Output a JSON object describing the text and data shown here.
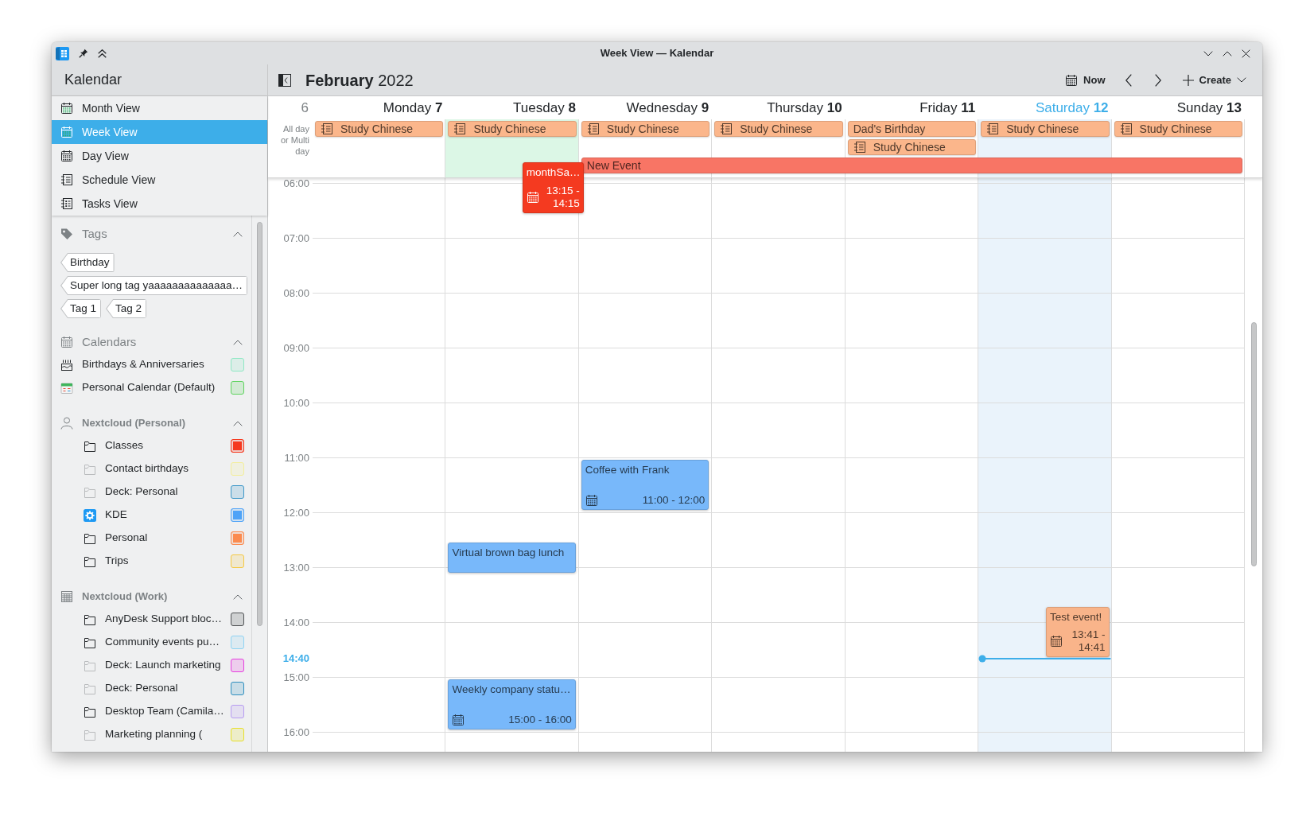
{
  "window": {
    "title": "Week View — Kalendar"
  },
  "sidebar": {
    "title": "Kalendar",
    "views": [
      {
        "label": "Month View",
        "kind": "month",
        "selected": false
      },
      {
        "label": "Week View",
        "kind": "week",
        "selected": true
      },
      {
        "label": "Day View",
        "kind": "day",
        "selected": false
      },
      {
        "label": "Schedule View",
        "kind": "schedule",
        "selected": false
      },
      {
        "label": "Tasks View",
        "kind": "tasks",
        "selected": false
      }
    ],
    "sections": [
      {
        "title": "Tags",
        "kind": "tags",
        "expanded": true,
        "tags": [
          "Birthday",
          "Super long tag yaaaaaaaaaaaaaa…",
          "Tag 1",
          "Tag 2"
        ]
      },
      {
        "title": "Calendars",
        "kind": "local",
        "expanded": true,
        "items": [
          {
            "label": "Birthdays & Anniversaries",
            "kind": "birthdays",
            "color": "#8fe8c4",
            "checked": false
          },
          {
            "label": "Personal Calendar (Default)",
            "kind": "calendar",
            "color": "#5ed35e",
            "checked": false
          }
        ]
      },
      {
        "title": "Nextcloud (Personal)",
        "kind": "account",
        "expanded": true,
        "items": [
          {
            "label": "Classes",
            "kind": "folder",
            "dimmed": false,
            "color": "#f5391f",
            "checked": true
          },
          {
            "label": "Contact birthdays",
            "kind": "folder",
            "dimmed": true,
            "color": "#f3ee9c",
            "checked": false
          },
          {
            "label": "Deck: Personal",
            "kind": "folder",
            "dimmed": true,
            "color": "#3d97c8",
            "checked": false
          },
          {
            "label": "KDE",
            "kind": "logo",
            "color": "#4fa3f7",
            "checked": true
          },
          {
            "label": "Personal",
            "kind": "folder",
            "dimmed": false,
            "color": "#fb8b4f",
            "checked": true
          },
          {
            "label": "Trips",
            "kind": "folder",
            "dimmed": false,
            "color": "#f5c842",
            "checked": false
          }
        ]
      },
      {
        "title": "Nextcloud (Work)",
        "kind": "shared",
        "expanded": true,
        "items": [
          {
            "label": "AnyDesk Support bloc…",
            "kind": "folder",
            "dimmed": false,
            "color": "#505355",
            "checked": false
          },
          {
            "label": "Community events pu…",
            "kind": "folder",
            "dimmed": false,
            "color": "#8fd3f3",
            "checked": false
          },
          {
            "label": "Deck: Launch marketing",
            "kind": "folder",
            "dimmed": true,
            "color": "#e63fdf",
            "checked": false
          },
          {
            "label": "Deck: Personal",
            "kind": "folder",
            "dimmed": true,
            "color": "#2f8fbf",
            "checked": false
          },
          {
            "label": "Desktop Team (Camila…",
            "kind": "folder",
            "dimmed": false,
            "color": "#b79cf1",
            "checked": false
          },
          {
            "label": "Marketing planning (",
            "kind": "folder",
            "dimmed": true,
            "color": "#e7df2a",
            "checked": false
          }
        ]
      }
    ]
  },
  "toolbar": {
    "title": "**February** 2022",
    "now": "Now",
    "create": "Create"
  },
  "week": {
    "number": "6",
    "all_day_label": "All day or Multi day",
    "hours": [
      "06:00",
      "07:00",
      "08:00",
      "09:00",
      "10:00",
      "11:00",
      "12:00",
      "13:00",
      "14:00",
      "15:00",
      "16:00"
    ],
    "now": "14:40"
  },
  "days": [
    {
      "label": "Monday **7**",
      "today": false,
      "highlighted": false,
      "all_day": [
        {
          "title": "Study Chinese",
          "kind": "task",
          "color": "#fbb68b"
        }
      ]
    },
    {
      "label": "Tuesday **8**",
      "today": false,
      "highlighted": true,
      "all_day": [
        {
          "title": "Study Chinese",
          "kind": "task",
          "color": "#fbb68b"
        }
      ],
      "events": [
        {
          "title": "monthSa…",
          "kind": "floating",
          "color": "#f43a20",
          "time": "13:15 - 14:15"
        },
        {
          "title": "Virtual brown bag lunch",
          "kind": "timed",
          "color": "#78b8fa"
        },
        {
          "title": "Weekly company statu…",
          "kind": "timed",
          "color": "#78b8fa",
          "time": "15:00 - 16:00"
        }
      ]
    },
    {
      "label": "Wednesday **9**",
      "today": false,
      "highlighted": false,
      "all_day": [
        {
          "title": "Study Chinese",
          "kind": "task",
          "color": "#fbb68b"
        },
        {
          "title": "New Event",
          "kind": "event",
          "color": "#f87565",
          "through_week_end": true
        }
      ],
      "events": [
        {
          "title": "Coffee with Frank",
          "kind": "timed",
          "color": "#78b8fa",
          "time": "11:00 - 12:00"
        }
      ]
    },
    {
      "label": "Thursday **10**",
      "today": false,
      "highlighted": false,
      "all_day": [
        {
          "title": "Study Chinese",
          "kind": "task",
          "color": "#fbb68b"
        }
      ]
    },
    {
      "label": "Friday **11**",
      "today": false,
      "highlighted": false,
      "all_day": [
        {
          "title": "Dad's Birthday",
          "kind": "event",
          "color": "#fbb68b"
        },
        {
          "title": "Study Chinese",
          "kind": "task",
          "color": "#fbb68b"
        }
      ]
    },
    {
      "label": "Saturday **12**",
      "today": true,
      "highlighted": false,
      "all_day": [
        {
          "title": "Study Chinese",
          "kind": "task",
          "color": "#fbb68b"
        }
      ],
      "events": [
        {
          "title": "Test event!",
          "kind": "timed",
          "color": "#f9b48a",
          "time": "13:41 - 14:41"
        }
      ]
    },
    {
      "label": "Sunday **13**",
      "today": false,
      "highlighted": false,
      "all_day": [
        {
          "title": "Study Chinese",
          "kind": "task",
          "color": "#fbb68b"
        }
      ]
    }
  ]
}
